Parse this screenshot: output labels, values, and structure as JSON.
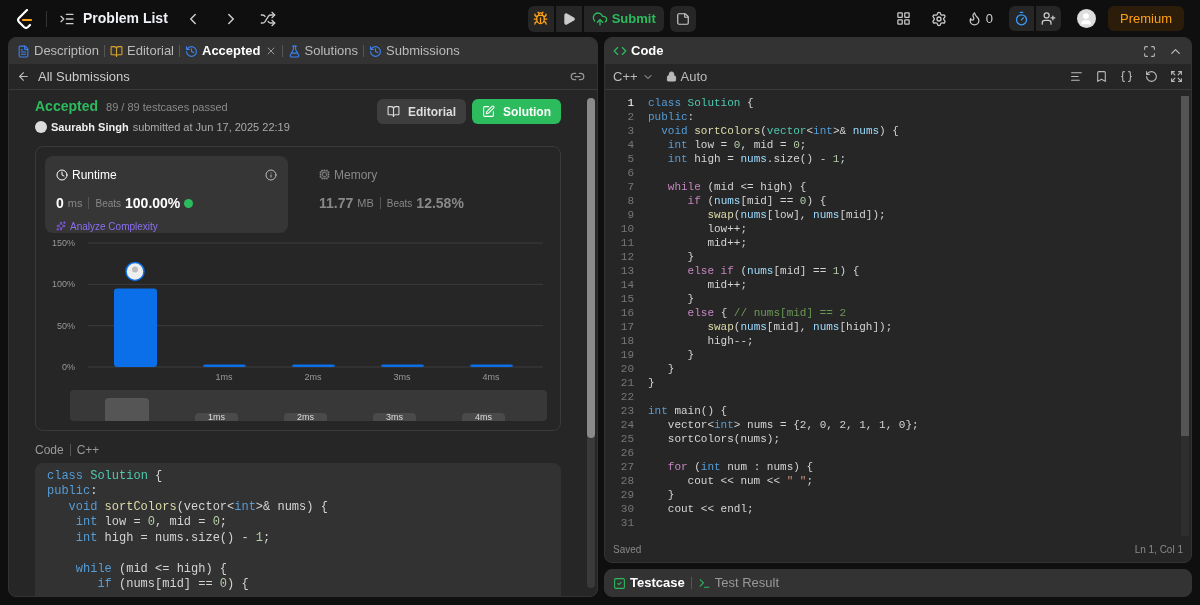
{
  "topbar": {
    "title": "Problem List",
    "submit": "Submit",
    "streak": "0",
    "premium": "Premium"
  },
  "left_tabs": [
    {
      "label": "Description",
      "selected": false,
      "closable": false
    },
    {
      "label": "Editorial",
      "selected": false,
      "closable": false
    },
    {
      "label": "Accepted",
      "selected": true,
      "closable": true
    },
    {
      "label": "Solutions",
      "selected": false,
      "closable": false
    },
    {
      "label": "Submissions",
      "selected": false,
      "closable": false
    }
  ],
  "back_link": "All Submissions",
  "result": {
    "status": "Accepted",
    "testcases": "89 / 89 testcases passed",
    "user": "Saurabh Singh",
    "submitted": "submitted at Jun 17, 2025 22:19",
    "editorial_button": "Editorial",
    "solution_button": "Solution"
  },
  "runtime": {
    "title": "Runtime",
    "value": "0",
    "unit": "ms",
    "beats_label": "Beats",
    "beats": "100.00%",
    "analyze": "Analyze Complexity",
    "selected": true
  },
  "memory": {
    "title": "Memory",
    "value": "11.77",
    "unit": "MB",
    "beats_label": "Beats",
    "beats": "12.58%",
    "selected": false
  },
  "chart_data": {
    "type": "bar",
    "categories": [
      null,
      "1ms",
      "2ms",
      "3ms",
      "4ms"
    ],
    "series": [
      {
        "color": "#0a6fe8",
        "values": [
          95,
          3,
          3,
          3,
          3
        ]
      }
    ],
    "ylim": [
      0,
      150
    ],
    "yticks": [
      {
        "value": 0,
        "label": "0%"
      },
      {
        "value": 50,
        "label": "50%"
      },
      {
        "value": 100,
        "label": "100%"
      },
      {
        "value": 150,
        "label": "150%"
      }
    ]
  },
  "chart_navigator": {
    "labels": [
      "1ms",
      "2ms",
      "3ms",
      "4ms"
    ]
  },
  "code_header": {
    "title": "Code",
    "language": "C++"
  },
  "submitted_code": [
    {
      "kind": "code",
      "tokens": [
        {
          "kind": "kw",
          "text": "class "
        },
        {
          "kind": "type",
          "text": "Solution"
        },
        {
          "kind": "plain",
          "text": " {"
        }
      ]
    },
    {
      "kind": "code",
      "tokens": [
        {
          "kind": "kw",
          "text": "public"
        },
        {
          "kind": "plain",
          "text": ":"
        }
      ]
    },
    {
      "kind": "code",
      "tokens": [
        {
          "kind": "kw",
          "text": "   void "
        },
        {
          "kind": "fn",
          "text": "sortColors"
        },
        {
          "kind": "plain",
          "text": "(vector<"
        },
        {
          "kind": "kw",
          "text": "int"
        },
        {
          "kind": "plain",
          "text": ">& nums) {"
        }
      ]
    },
    {
      "kind": "code",
      "tokens": [
        {
          "kind": "kw",
          "text": "    int "
        },
        {
          "kind": "plain",
          "text": "low = "
        },
        {
          "kind": "num",
          "text": "0"
        },
        {
          "kind": "plain",
          "text": ", mid = "
        },
        {
          "kind": "num",
          "text": "0"
        },
        {
          "kind": "plain",
          "text": ";"
        }
      ]
    },
    {
      "kind": "code",
      "tokens": [
        {
          "kind": "kw",
          "text": "    int "
        },
        {
          "kind": "plain",
          "text": "high = nums.size() - "
        },
        {
          "kind": "num",
          "text": "1"
        },
        {
          "kind": "plain",
          "text": ";"
        }
      ]
    },
    {
      "kind": "blank"
    },
    {
      "kind": "code",
      "tokens": [
        {
          "kind": "kw",
          "text": "    while "
        },
        {
          "kind": "plain",
          "text": "(mid <= high) {"
        }
      ]
    },
    {
      "kind": "code",
      "tokens": [
        {
          "kind": "kw",
          "text": "       if "
        },
        {
          "kind": "plain",
          "text": "(nums[mid] == "
        },
        {
          "kind": "num",
          "text": "0"
        },
        {
          "kind": "plain",
          "text": ") {"
        }
      ]
    }
  ],
  "editor": {
    "title": "Code",
    "language": "C++",
    "mode": "Auto",
    "status": "Saved",
    "cursor": "Ln 1, Col 1"
  },
  "editor_lines": [
    {
      "number": "1",
      "tokens": [
        {
          "kind": "kw",
          "text": "class "
        },
        {
          "kind": "type",
          "text": "Solution"
        },
        {
          "kind": "plain",
          "text": " {"
        }
      ]
    },
    {
      "number": "2",
      "tokens": [
        {
          "kind": "kw",
          "text": "public"
        },
        {
          "kind": "plain",
          "text": ":"
        }
      ]
    },
    {
      "number": "3",
      "tokens": [
        {
          "kind": "kw",
          "text": "  void "
        },
        {
          "kind": "fn",
          "text": "sortColors"
        },
        {
          "kind": "plain",
          "text": "("
        },
        {
          "kind": "type",
          "text": "vector"
        },
        {
          "kind": "plain",
          "text": "<"
        },
        {
          "kind": "kw",
          "text": "int"
        },
        {
          "kind": "plain",
          "text": ">& "
        },
        {
          "kind": "var",
          "text": "nums"
        },
        {
          "kind": "plain",
          "text": ") {"
        }
      ]
    },
    {
      "number": "4",
      "tokens": [
        {
          "kind": "kw",
          "text": "   int "
        },
        {
          "kind": "plain",
          "text": "low = "
        },
        {
          "kind": "num",
          "text": "0"
        },
        {
          "kind": "plain",
          "text": ", mid = "
        },
        {
          "kind": "num",
          "text": "0"
        },
        {
          "kind": "plain",
          "text": ";"
        }
      ]
    },
    {
      "number": "5",
      "tokens": [
        {
          "kind": "kw",
          "text": "   int "
        },
        {
          "kind": "plain",
          "text": "high = "
        },
        {
          "kind": "var",
          "text": "nums"
        },
        {
          "kind": "plain",
          "text": ".size() - "
        },
        {
          "kind": "num",
          "text": "1"
        },
        {
          "kind": "plain",
          "text": ";"
        }
      ]
    },
    {
      "number": "6"
    },
    {
      "number": "7",
      "tokens": [
        {
          "kind": "ctrl",
          "text": "   while "
        },
        {
          "kind": "plain",
          "text": "(mid <= high) {"
        }
      ]
    },
    {
      "number": "8",
      "tokens": [
        {
          "kind": "ctrl",
          "text": "      if "
        },
        {
          "kind": "plain",
          "text": "("
        },
        {
          "kind": "var",
          "text": "nums"
        },
        {
          "kind": "plain",
          "text": "[mid] == "
        },
        {
          "kind": "num",
          "text": "0"
        },
        {
          "kind": "plain",
          "text": ") {"
        }
      ]
    },
    {
      "number": "9",
      "tokens": [
        {
          "kind": "fn",
          "text": "         swap"
        },
        {
          "kind": "plain",
          "text": "("
        },
        {
          "kind": "var",
          "text": "nums"
        },
        {
          "kind": "plain",
          "text": "[low], "
        },
        {
          "kind": "var",
          "text": "nums"
        },
        {
          "kind": "plain",
          "text": "[mid]);"
        }
      ]
    },
    {
      "number": "10",
      "tokens": [
        {
          "kind": "plain",
          "text": "         low++;"
        }
      ]
    },
    {
      "number": "11",
      "tokens": [
        {
          "kind": "plain",
          "text": "         mid++;"
        }
      ]
    },
    {
      "number": "12",
      "tokens": [
        {
          "kind": "plain",
          "text": "      }"
        }
      ]
    },
    {
      "number": "13",
      "tokens": [
        {
          "kind": "ctrl",
          "text": "      else if "
        },
        {
          "kind": "plain",
          "text": "("
        },
        {
          "kind": "var",
          "text": "nums"
        },
        {
          "kind": "plain",
          "text": "[mid] == "
        },
        {
          "kind": "num",
          "text": "1"
        },
        {
          "kind": "plain",
          "text": ") {"
        }
      ]
    },
    {
      "number": "14",
      "tokens": [
        {
          "kind": "plain",
          "text": "         mid++;"
        }
      ]
    },
    {
      "number": "15",
      "tokens": [
        {
          "kind": "plain",
          "text": "      }"
        }
      ]
    },
    {
      "number": "16",
      "tokens": [
        {
          "kind": "ctrl",
          "text": "      else "
        },
        {
          "kind": "plain",
          "text": "{ "
        },
        {
          "kind": "cmt",
          "text": "// nums[mid] == 2"
        }
      ]
    },
    {
      "number": "17",
      "tokens": [
        {
          "kind": "fn",
          "text": "         swap"
        },
        {
          "kind": "plain",
          "text": "("
        },
        {
          "kind": "var",
          "text": "nums"
        },
        {
          "kind": "plain",
          "text": "[mid], "
        },
        {
          "kind": "var",
          "text": "nums"
        },
        {
          "kind": "plain",
          "text": "[high]);"
        }
      ]
    },
    {
      "number": "18",
      "tokens": [
        {
          "kind": "plain",
          "text": "         high--;"
        }
      ]
    },
    {
      "number": "19",
      "tokens": [
        {
          "kind": "plain",
          "text": "      }"
        }
      ]
    },
    {
      "number": "20",
      "tokens": [
        {
          "kind": "plain",
          "text": "   }"
        }
      ]
    },
    {
      "number": "21",
      "tokens": [
        {
          "kind": "plain",
          "text": "}"
        }
      ]
    },
    {
      "number": "22"
    },
    {
      "number": "23",
      "tokens": [
        {
          "kind": "kw",
          "text": "int "
        },
        {
          "kind": "plain",
          "text": "main() {"
        }
      ]
    },
    {
      "number": "24",
      "tokens": [
        {
          "kind": "plain",
          "text": "   vector<"
        },
        {
          "kind": "kw",
          "text": "int"
        },
        {
          "kind": "plain",
          "text": "> nums = {2, 0, 2, 1, 1, 0};"
        }
      ]
    },
    {
      "number": "25",
      "tokens": [
        {
          "kind": "plain",
          "text": "   sortColors(nums);"
        }
      ]
    },
    {
      "number": "26"
    },
    {
      "number": "27",
      "tokens": [
        {
          "kind": "ctrl",
          "text": "   for "
        },
        {
          "kind": "plain",
          "text": "("
        },
        {
          "kind": "kw",
          "text": "int "
        },
        {
          "kind": "plain",
          "text": "num : nums) {"
        }
      ]
    },
    {
      "number": "28",
      "tokens": [
        {
          "kind": "plain",
          "text": "      cout << num << "
        },
        {
          "kind": "str",
          "text": "\" \""
        },
        {
          "kind": "plain",
          "text": ";"
        }
      ]
    },
    {
      "number": "29",
      "tokens": [
        {
          "kind": "plain",
          "text": "   }"
        }
      ]
    },
    {
      "number": "30",
      "tokens": [
        {
          "kind": "plain",
          "text": "   cout << endl;"
        }
      ]
    },
    {
      "number": "31"
    }
  ],
  "bottom_tabs": [
    {
      "label": "Testcase",
      "selected": true
    },
    {
      "label": "Test Result",
      "selected": false
    }
  ]
}
